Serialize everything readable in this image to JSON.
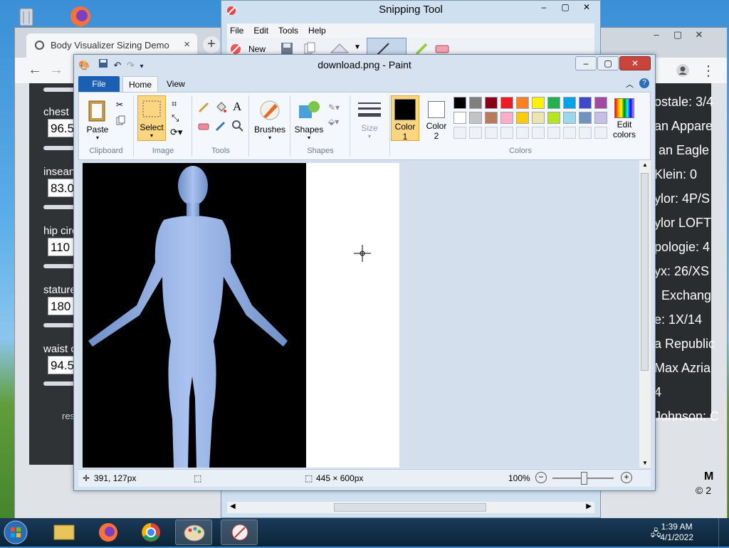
{
  "browser": {
    "tab_title": "Body Visualizer Sizing Demo",
    "tab_close": "×",
    "new_tab": "+",
    "window_controls": [
      "–",
      "▢",
      "✕"
    ],
    "left_panel": {
      "fields": [
        {
          "label": "chest",
          "value": "96.5"
        },
        {
          "label": "insean",
          "value": "83.0"
        },
        {
          "label": "hip circ",
          "value": "110"
        },
        {
          "label": "stature",
          "value": "180"
        },
        {
          "label": "waist c",
          "value": "94.5"
        }
      ],
      "reset": "res"
    },
    "right_panel": {
      "rows": [
        "ostale: 3/4",
        "an Appare",
        "an Eagle",
        "Klein: 0",
        "ylor: 4P/S",
        "ylor LOFT",
        "pologie: 4",
        "yx: 26/XS",
        "Exchang",
        "e: 1X/14",
        "a Republic",
        "Max Azria",
        "4",
        "Johnson: C"
      ]
    },
    "footer_letters": [
      "M",
      "© 2"
    ]
  },
  "snipping": {
    "title": "Snipping Tool",
    "menu": [
      "File",
      "Edit",
      "Tools",
      "Help"
    ],
    "new_label": "New",
    "window_controls": [
      "–",
      "▢",
      "✕"
    ]
  },
  "paint": {
    "title": "download.png - Paint",
    "tabs": {
      "file": "File",
      "home": "Home",
      "view": "View"
    },
    "clipboard": {
      "paste": "Paste",
      "group": "Clipboard"
    },
    "image": {
      "select": "Select",
      "group": "Image"
    },
    "tools": {
      "group": "Tools",
      "text_tool": "A"
    },
    "brushes": {
      "label": "Brushes"
    },
    "shapes": {
      "label": "Shapes",
      "group": "Shapes"
    },
    "size": {
      "label": "Size"
    },
    "colors": {
      "color1": "Color",
      "color1_num": "1",
      "color2": "Color",
      "color2_num": "2",
      "edit": "Edit",
      "edit2": "colors",
      "group": "Colors",
      "row1": [
        "#000000",
        "#7f7f7f",
        "#880015",
        "#ed1c24",
        "#ff7f27",
        "#fff200",
        "#22b14c",
        "#00a2e8",
        "#3f48cc",
        "#a349a4"
      ],
      "row2": [
        "#ffffff",
        "#c3c3c3",
        "#b97a57",
        "#ffaec9",
        "#ffc90e",
        "#efe4b0",
        "#b5e61d",
        "#99d9ea",
        "#7092be",
        "#c8bfe7"
      ]
    },
    "status": {
      "cursor": "391, 127px",
      "dims": "445 × 600px",
      "zoom": "100%"
    },
    "window_controls": [
      "–",
      "▢",
      "✕"
    ]
  },
  "taskbar": {
    "time": "1:39 AM",
    "date": "4/1/2022"
  }
}
